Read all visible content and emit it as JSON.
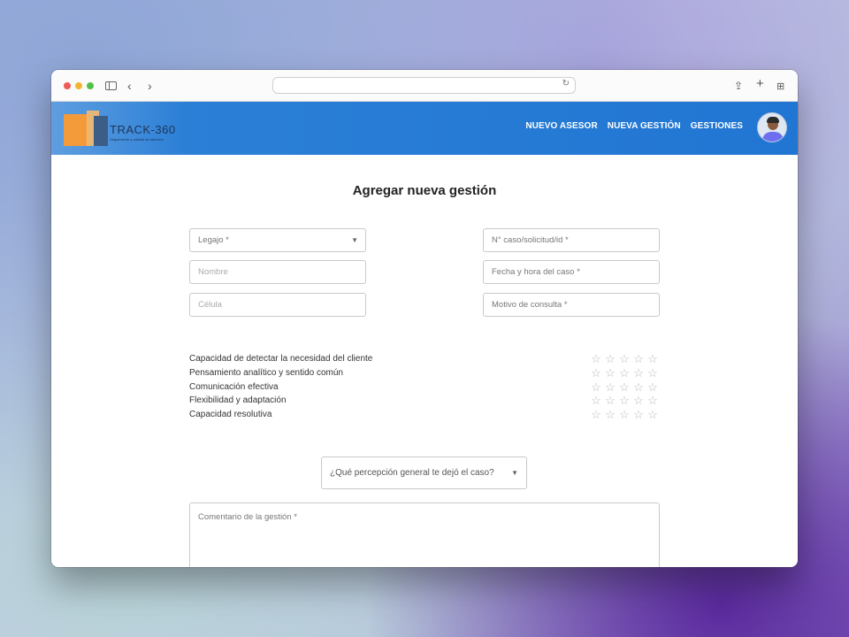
{
  "browser": {
    "url": ""
  },
  "header": {
    "logo_title": "TRACK-360",
    "logo_subtitle": "Seguimiento y calidad de atención",
    "nav": [
      "NUEVO ASESOR",
      "NUEVA GESTIÓN",
      "GESTIONES"
    ]
  },
  "form": {
    "title": "Agregar nueva gestión",
    "legajo_label": "Legajo *",
    "nombre_placeholder": "Nombre",
    "celula_placeholder": "Célula",
    "caso_label": "N° caso/solicitud/id *",
    "fecha_label": "Fecha y hora del caso *",
    "motivo_label": "Motivo de consulta *",
    "criteria": [
      {
        "label": "Capacidad de detectar la necesidad del cliente",
        "rating": 0,
        "max": 5
      },
      {
        "label": "Pensamiento analítico y sentido común",
        "rating": 0,
        "max": 5
      },
      {
        "label": "Comunicación efectiva",
        "rating": 0,
        "max": 5
      },
      {
        "label": "Flexibilidad y adaptación",
        "rating": 0,
        "max": 5
      },
      {
        "label": "Capacidad resolutiva",
        "rating": 0,
        "max": 5
      }
    ],
    "perception_label": "¿Qué percepción general te dejó el caso?",
    "comment_label": "Comentario de la gestión *"
  },
  "icons": {
    "star": "star-outline-icon",
    "caret": "caret-down-icon"
  },
  "colors": {
    "header": "#2176d3",
    "star": "#b8b8b8"
  }
}
